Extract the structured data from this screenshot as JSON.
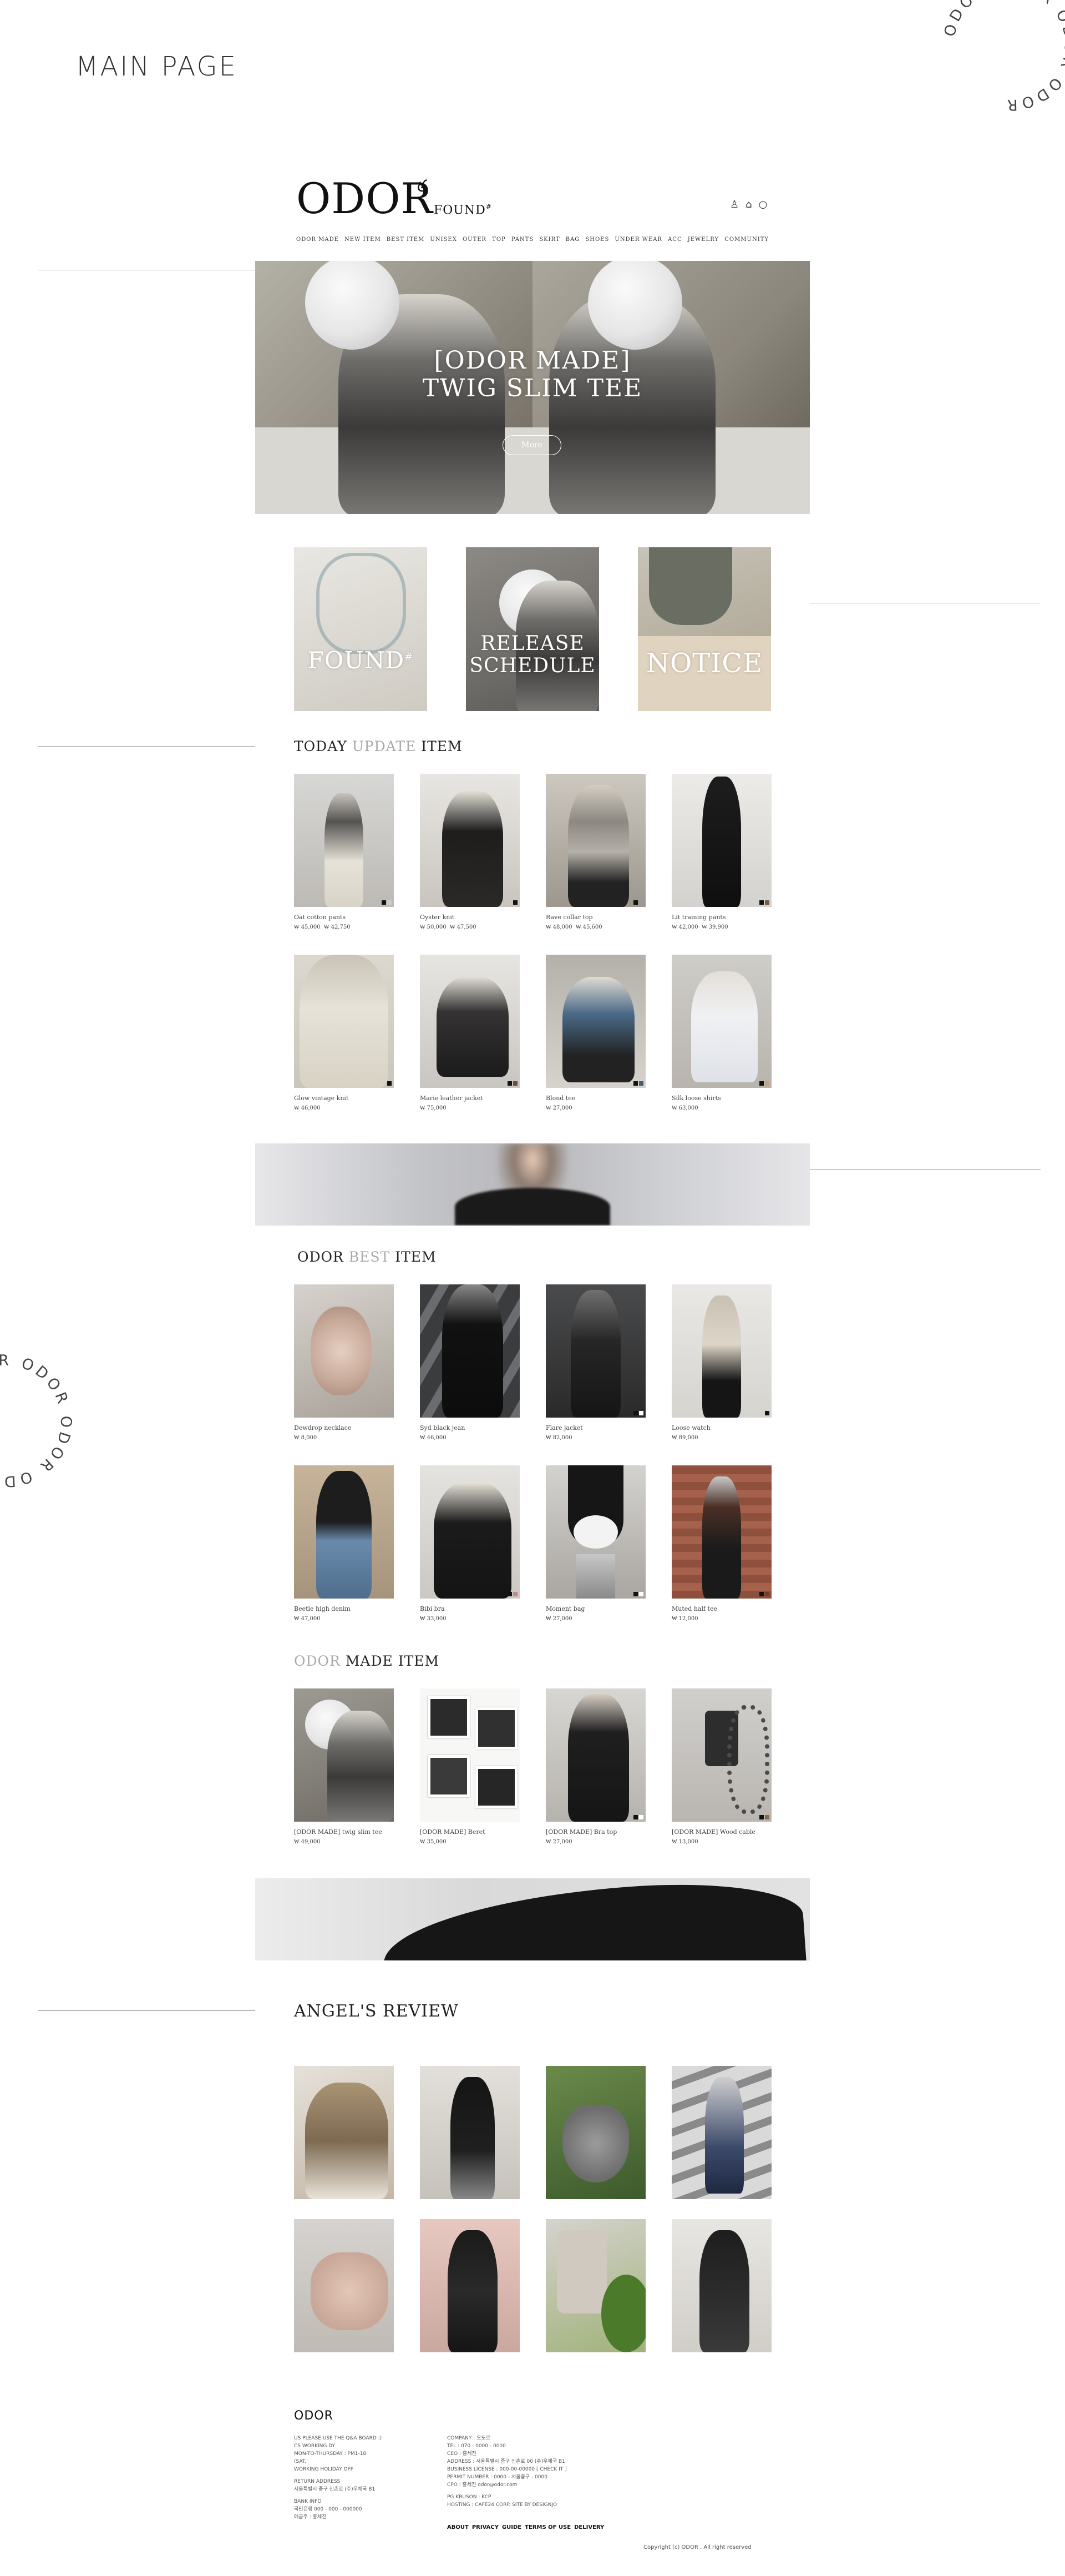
{
  "page_title": "MAIN PAGE",
  "circle_text": "ODOR ODOR ODOR ODOR",
  "header": {
    "logo": "ODOR",
    "logo_sub": "FOUND",
    "logo_sub_mark": "#",
    "icons": [
      "user-icon",
      "bag-icon",
      "search-icon"
    ]
  },
  "nav": [
    "ODOR MADE",
    "NEW ITEM",
    "BEST ITEM",
    "UNISEX",
    "OUTER",
    "TOP",
    "PANTS",
    "SKIRT",
    "BAG",
    "SHOES",
    "UNDER WEAR",
    "ACC",
    "JEWELRY",
    "COMMUNITY"
  ],
  "hero": {
    "line1": "[ODOR MADE]",
    "line2": "TWIG SLIM TEE",
    "button": "More"
  },
  "tiles": [
    {
      "label": "FOUND",
      "mark": "#"
    },
    {
      "label_line1": "RELEASE",
      "label_line2": "SCHEDULE"
    },
    {
      "label": "NOTICE"
    }
  ],
  "today": {
    "title_a": "TODAY",
    "title_b": "UPDATE",
    "title_c": "ITEM",
    "items": [
      {
        "name": "Oat cotton pants",
        "price": "₩ 45,000",
        "sale": "₩ 42,750"
      },
      {
        "name": "Oyster knit",
        "price": "₩ 50,000",
        "sale": "₩ 47,500"
      },
      {
        "name": "Rave collar top",
        "price": "₩ 48,000",
        "sale": "₩ 45,600"
      },
      {
        "name": "Lit training pants",
        "price": "₩ 42,000",
        "sale": "₩ 39,900"
      },
      {
        "name": "Glow vintage knit",
        "price": "₩ 46,000",
        "sale": ""
      },
      {
        "name": "Marie leather jacket",
        "price": "₩ 75,000",
        "sale": ""
      },
      {
        "name": "Blond tee",
        "price": "₩ 27,000",
        "sale": ""
      },
      {
        "name": "Silk loose shirts",
        "price": "₩ 63,000",
        "sale": ""
      }
    ]
  },
  "best": {
    "title_a": "ODOR",
    "title_b": "BEST",
    "title_c": "ITEM",
    "items": [
      {
        "name": "Dewdrop necklace",
        "price": "₩ 8,000"
      },
      {
        "name": "Syd black jean",
        "price": "₩ 46,000"
      },
      {
        "name": "Flare jacket",
        "price": "₩ 82,000"
      },
      {
        "name": "Loose watch",
        "price": "₩ 89,000"
      },
      {
        "name": "Beetle high denim",
        "price": "₩ 47,000"
      },
      {
        "name": "Bibi bra",
        "price": "₩ 33,000"
      },
      {
        "name": "Moment bag",
        "price": "₩ 27,000"
      },
      {
        "name": "Muted half tee",
        "price": "₩ 12,000"
      }
    ]
  },
  "made": {
    "title_a": "ODOR",
    "title_b": "MADE ITEM",
    "items": [
      {
        "name": "[ODOR MADE] twig slim tee",
        "price": "₩ 49,000"
      },
      {
        "name": "[ODOR MADE] Beret",
        "price": "₩ 35,000"
      },
      {
        "name": "[ODOR MADE] Bra top",
        "price": "₩ 27,000"
      },
      {
        "name": "[ODOR MADE] Wood cable",
        "price": "₩ 13,000"
      }
    ]
  },
  "review": {
    "title": "ANGEL'S REVIEW"
  },
  "footer": {
    "logo": "ODOR",
    "col1": [
      "US PLEASE USE THE Q&A BOARD :)",
      "CS WORKING DY",
      "MON-TO-THURSDAY : PM1-18",
      "(SAT.",
      "WORKING HOLIDAY OFF",
      "",
      "RETURN ADDRESS",
      "서울특별시 중구 신촌로 (주)우체국 B1",
      "",
      "BANK INFO",
      "국민은행 000 - 000 - 000000",
      "예금주 : 홍세진"
    ],
    "col2": [
      "COMPANY : 오도르",
      "TEL : 070 - 0000 - 0000",
      "CEO : 홍세진",
      "ADDRESS : 서울특별시 중구 신촌로 00 (주)우체국 B1",
      "BUSINESS LICENSE : 000-00-00000 [ CHECK IT ]",
      "PERMIT NUMBER : 0000 - 서울중구 - 0000",
      "CPO : 홍세진 odor@odor.com",
      "",
      "PG KBUSON : KCP",
      "HOSTING : CAFE24 CORP.  SITE BY DESIGNJO"
    ],
    "links": [
      "ABOUT",
      "PRIVACY",
      "GUIDE",
      "TERMS OF USE",
      "DELIVERY"
    ],
    "copyright": "Copyright (c) ODOR . All right reserved"
  }
}
